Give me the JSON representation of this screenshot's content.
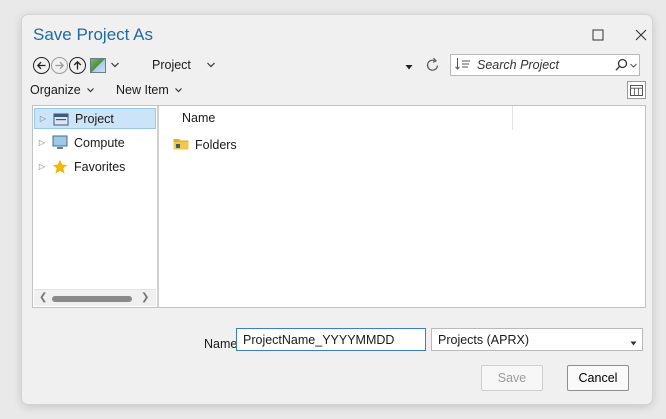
{
  "window": {
    "title": "Save Project As",
    "maximize_icon": "maximize-icon",
    "close_icon": "close-icon"
  },
  "navigation": {
    "back_icon": "back-arrow-icon",
    "forward_icon": "forward-arrow-icon",
    "up_icon": "up-arrow-icon",
    "location_label": "Project",
    "refresh_icon": "refresh-icon"
  },
  "search": {
    "placeholder": "Search Project",
    "sort_icon": "sort-icon",
    "search_icon": "search-icon"
  },
  "toolbar": {
    "organize_label": "Organize",
    "new_item_label": "New Item",
    "view_icon": "view-pane-icon"
  },
  "tree": {
    "items": [
      {
        "label": "Project",
        "icon": "project-icon",
        "selected": true
      },
      {
        "label": "Compute",
        "icon": "computer-icon",
        "selected": false
      },
      {
        "label": "Favorites",
        "icon": "star-icon",
        "selected": false
      }
    ]
  },
  "file_list": {
    "column_name": "Name",
    "rows": [
      {
        "label": "Folders",
        "icon": "folder-icon"
      }
    ]
  },
  "form": {
    "name_label": "Name",
    "name_value": "ProjectName_YYYYMMDD",
    "type_value": "Projects (APRX)"
  },
  "buttons": {
    "save_label": "Save",
    "cancel_label": "Cancel"
  },
  "colors": {
    "title": "#1f6aa5",
    "selection": "#cce4f7",
    "star": "#f2b705",
    "folder": "#e8b02a"
  }
}
